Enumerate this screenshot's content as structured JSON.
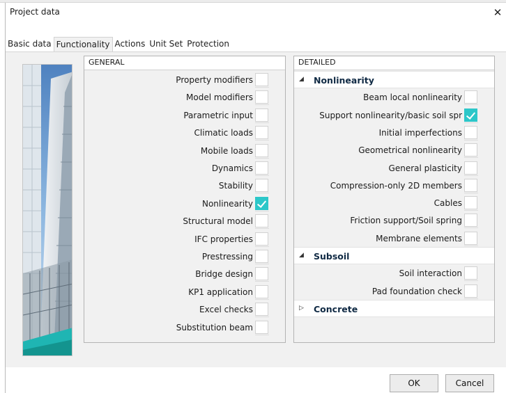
{
  "window": {
    "title": "Project data",
    "close_glyph": "✕"
  },
  "tabs": [
    {
      "label": "Basic data",
      "active": false
    },
    {
      "label": "Functionality",
      "active": true
    },
    {
      "label": "Actions",
      "active": false
    },
    {
      "label": "Unit Set",
      "active": false
    },
    {
      "label": "Protection",
      "active": false
    }
  ],
  "general": {
    "header": "GENERAL",
    "items": [
      {
        "label": "Property modifiers",
        "checked": false
      },
      {
        "label": "Model modifiers",
        "checked": false
      },
      {
        "label": "Parametric input",
        "checked": false
      },
      {
        "label": "Climatic loads",
        "checked": false
      },
      {
        "label": "Mobile loads",
        "checked": false
      },
      {
        "label": "Dynamics",
        "checked": false
      },
      {
        "label": "Stability",
        "checked": false
      },
      {
        "label": "Nonlinearity",
        "checked": true
      },
      {
        "label": "Structural model",
        "checked": false
      },
      {
        "label": "IFC properties",
        "checked": false
      },
      {
        "label": "Prestressing",
        "checked": false
      },
      {
        "label": "Bridge design",
        "checked": false
      },
      {
        "label": "KP1 application",
        "checked": false
      },
      {
        "label": "Excel checks",
        "checked": false
      },
      {
        "label": "Substitution beam",
        "checked": false
      }
    ]
  },
  "detailed": {
    "header": "DETAILED",
    "groups": [
      {
        "name": "Nonlinearity",
        "expanded": true,
        "arrow": "◢",
        "items": [
          {
            "label": "Beam local nonlinearity",
            "checked": false
          },
          {
            "label": "Support nonlinearity/basic soil spr",
            "checked": true
          },
          {
            "label": "Initial imperfections",
            "checked": false
          },
          {
            "label": "Geometrical nonlinearity",
            "checked": false
          },
          {
            "label": "General plasticity",
            "checked": false
          },
          {
            "label": "Compression-only 2D members",
            "checked": false
          },
          {
            "label": "Cables",
            "checked": false
          },
          {
            "label": "Friction support/Soil spring",
            "checked": false
          },
          {
            "label": "Membrane elements",
            "checked": false
          }
        ]
      },
      {
        "name": "Subsoil",
        "expanded": true,
        "arrow": "◢",
        "items": [
          {
            "label": "Soil interaction",
            "checked": false
          },
          {
            "label": "Pad foundation check",
            "checked": false
          }
        ]
      },
      {
        "name": "Concrete",
        "expanded": false,
        "arrow": "▷",
        "items": []
      }
    ]
  },
  "buttons": {
    "ok": "OK",
    "cancel": "Cancel"
  },
  "colors": {
    "check_accent": "#2cc7c9",
    "group_text": "#102a44"
  }
}
